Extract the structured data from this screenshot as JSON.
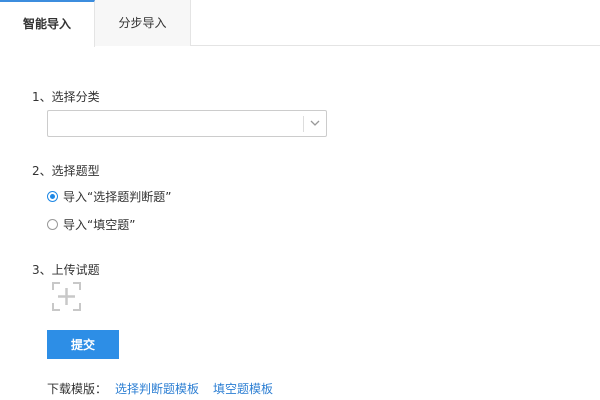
{
  "tabs": [
    {
      "label": "智能导入",
      "active": true
    },
    {
      "label": "分步导入",
      "active": false
    }
  ],
  "steps": {
    "category_label": "1、选择分类",
    "category_value": "",
    "type_label": "2、选择题型",
    "type_options": [
      {
        "label": "导入“选择题判断题”",
        "checked": true
      },
      {
        "label": "导入“填空题”",
        "checked": false
      }
    ],
    "upload_label": "3、上传试题"
  },
  "submit_label": "提交",
  "download": {
    "label": "下载模版：",
    "links": [
      "选择判断题模板",
      "填空题模板"
    ]
  },
  "colors": {
    "accent": "#2d8ee6",
    "link": "#2d7fd3",
    "radio_checked": "#1e88e5"
  }
}
